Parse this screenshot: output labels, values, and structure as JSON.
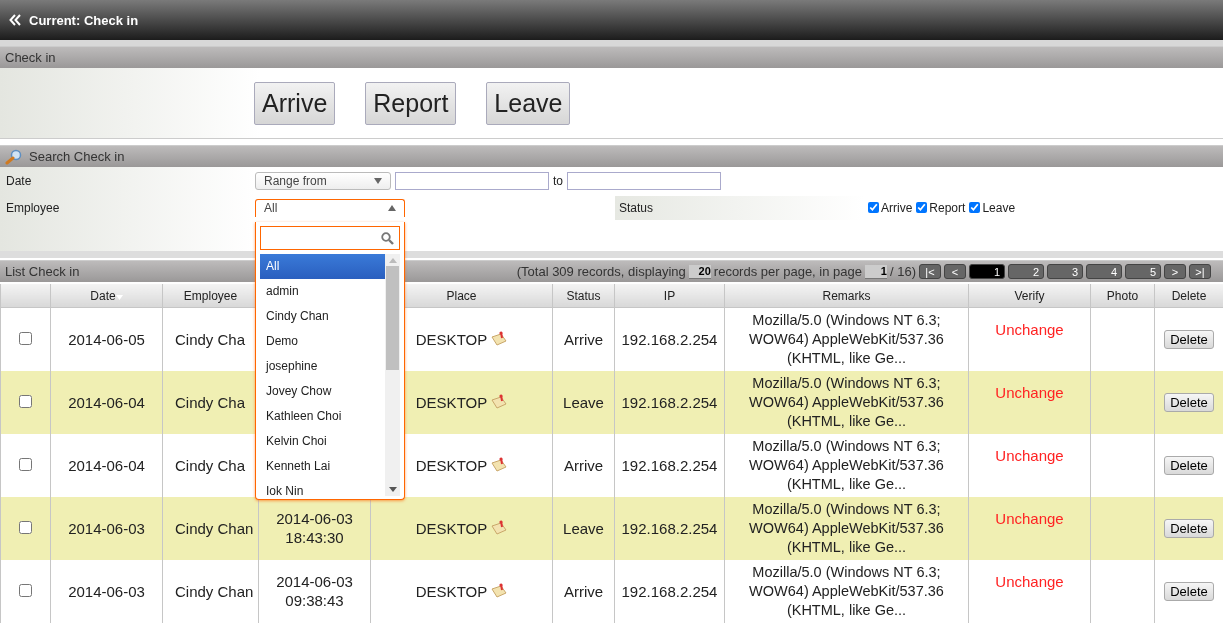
{
  "header": {
    "title": "Current: Check in"
  },
  "checkin_panel": {
    "title": "Check in",
    "buttons": [
      "Arrive",
      "Report",
      "Leave"
    ]
  },
  "search_panel": {
    "title": "Search Check in",
    "date_label": "Date",
    "date_mode": "Range from",
    "to_label": "to",
    "employee_label": "Employee",
    "employee_value": "All",
    "status_label": "Status",
    "status_options": [
      {
        "label": "Arrive",
        "checked": true
      },
      {
        "label": "Report",
        "checked": true
      },
      {
        "label": "Leave",
        "checked": true
      }
    ]
  },
  "employee_dropdown": {
    "items": [
      {
        "label": "All",
        "selected": true
      },
      {
        "label": "admin",
        "selected": false
      },
      {
        "label": "Cindy Chan",
        "selected": false
      },
      {
        "label": "Demo",
        "selected": false
      },
      {
        "label": "josephine",
        "selected": false
      },
      {
        "label": "Jovey Chow",
        "selected": false
      },
      {
        "label": "Kathleen Choi",
        "selected": false
      },
      {
        "label": "Kelvin Choi",
        "selected": false
      },
      {
        "label": "Kenneth Lai",
        "selected": false
      },
      {
        "label": "Iok Nin",
        "selected": false
      }
    ]
  },
  "list_panel": {
    "title": "List Check in",
    "pagination": {
      "text_before": "(Total 309 records, displaying",
      "per_page": "20",
      "text_middle": "records per page, in page",
      "page": "1",
      "text_after": "/ 16)",
      "first": "|<",
      "prev": "<",
      "next": ">",
      "last": ">|",
      "pages": [
        {
          "label": "1",
          "selected": true
        },
        {
          "label": "2",
          "selected": false
        },
        {
          "label": "3",
          "selected": false
        },
        {
          "label": "4",
          "selected": false
        },
        {
          "label": "5",
          "selected": false
        }
      ]
    }
  },
  "table": {
    "columns": [
      {},
      {
        "label": "Date",
        "sorted": true
      },
      {
        "label": "Employee"
      },
      {},
      {
        "label": "Place"
      },
      {
        "label": "Status"
      },
      {
        "label": "IP"
      },
      {
        "label": "Remarks"
      },
      {
        "label": "Verify"
      },
      {
        "label": "Photo"
      },
      {
        "label": "Delete"
      }
    ],
    "rows": [
      {
        "checked": false,
        "date": "2014-06-05",
        "employee": "Cindy Cha",
        "place": "DESKTOP",
        "status": "Arrive",
        "ip": "192.168.2.254",
        "remarks": "Mozilla/5.0 (Windows NT 6.3; WOW64) AppleWebKit/537.36 (KHTML, like Ge...",
        "verify": "Unchange",
        "action": "Delete"
      },
      {
        "checked": false,
        "date": "2014-06-04",
        "employee": "Cindy Cha",
        "place": "DESKTOP",
        "status": "Leave",
        "ip": "192.168.2.254",
        "remarks": "Mozilla/5.0 (Windows NT 6.3; WOW64) AppleWebKit/537.36 (KHTML, like Ge...",
        "verify": "Unchange",
        "action": "Delete"
      },
      {
        "checked": false,
        "date": "2014-06-04",
        "employee": "Cindy Cha",
        "place": "DESKTOP",
        "status": "Arrive",
        "ip": "192.168.2.254",
        "remarks": "Mozilla/5.0 (Windows NT 6.3; WOW64) AppleWebKit/537.36 (KHTML, like Ge...",
        "verify": "Unchange",
        "action": "Delete"
      },
      {
        "checked": false,
        "date": "2014-06-03",
        "employee": "Cindy Chan",
        "time": "2014-06-03 18:43:30",
        "place": "DESKTOP",
        "status": "Leave",
        "ip": "192.168.2.254",
        "remarks": "Mozilla/5.0 (Windows NT 6.3; WOW64) AppleWebKit/537.36 (KHTML, like Ge...",
        "verify": "Unchange",
        "action": "Delete"
      },
      {
        "checked": false,
        "date": "2014-06-03",
        "employee": "Cindy Chan",
        "time": "2014-06-03 09:38:43",
        "place": "DESKTOP",
        "status": "Arrive",
        "ip": "192.168.2.254",
        "remarks": "Mozilla/5.0 (Windows NT 6.3; WOW64) AppleWebKit/537.36 (KHTML, like Ge...",
        "verify": "Unchange",
        "action": "Delete"
      }
    ]
  }
}
